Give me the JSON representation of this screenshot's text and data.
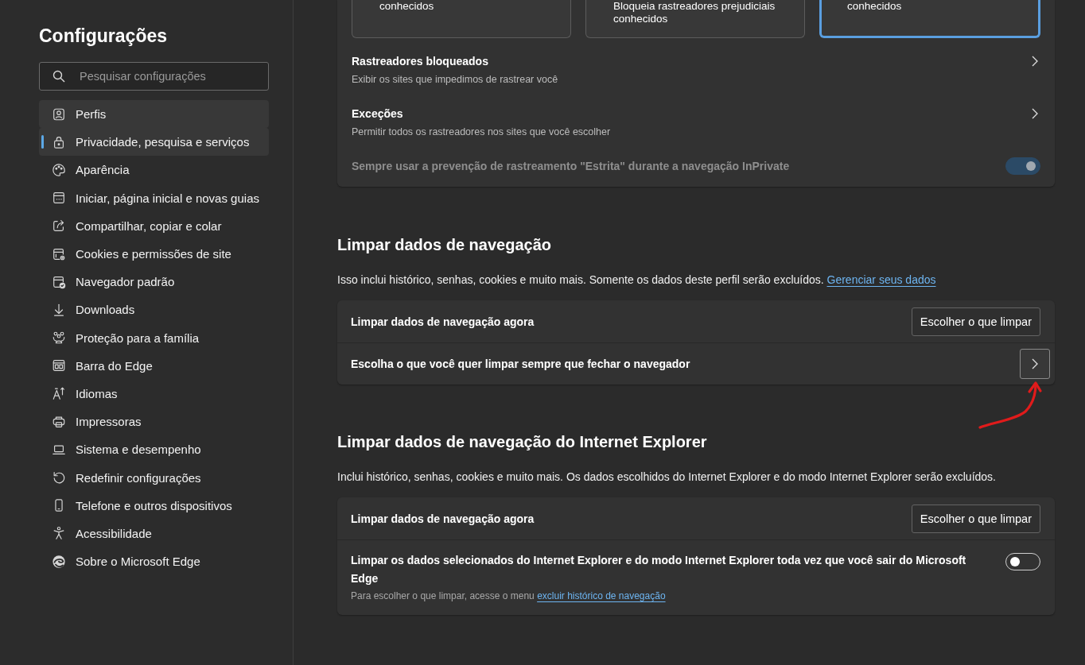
{
  "sidebar": {
    "title": "Configurações",
    "search": {
      "placeholder": "Pesquisar configurações"
    },
    "items": [
      {
        "label": "Perfis",
        "selected": false,
        "hovered": true
      },
      {
        "label": "Privacidade, pesquisa e serviços",
        "selected": true,
        "hovered": false
      },
      {
        "label": "Aparência",
        "selected": false,
        "hovered": false
      },
      {
        "label": "Iniciar, página inicial e novas guias",
        "selected": false,
        "hovered": false
      },
      {
        "label": "Compartilhar, copiar e colar",
        "selected": false,
        "hovered": false
      },
      {
        "label": "Cookies e permissões de site",
        "selected": false,
        "hovered": false
      },
      {
        "label": "Navegador padrão",
        "selected": false,
        "hovered": false
      },
      {
        "label": "Downloads",
        "selected": false,
        "hovered": false
      },
      {
        "label": "Proteção para a família",
        "selected": false,
        "hovered": false
      },
      {
        "label": "Barra do Edge",
        "selected": false,
        "hovered": false
      },
      {
        "label": "Idiomas",
        "selected": false,
        "hovered": false
      },
      {
        "label": "Impressoras",
        "selected": false,
        "hovered": false
      },
      {
        "label": "Sistema e desempenho",
        "selected": false,
        "hovered": false
      },
      {
        "label": "Redefinir configurações",
        "selected": false,
        "hovered": false
      },
      {
        "label": "Telefone e outros dispositivos",
        "selected": false,
        "hovered": false
      },
      {
        "label": "Acessibilidade",
        "selected": false,
        "hovered": false
      },
      {
        "label": "Sobre o Microsoft Edge",
        "selected": false,
        "hovered": false
      }
    ]
  },
  "tracking": {
    "levels": [
      {
        "lines": [
          "conhecidos"
        ],
        "selected": false
      },
      {
        "lines": [
          "Bloqueia rastreadores prejudiciais",
          "conhecidos"
        ],
        "selected": false
      },
      {
        "lines": [
          "conhecidos"
        ],
        "selected": true
      }
    ],
    "rows": [
      {
        "kind": "chevron",
        "label": "Rastreadores bloqueados",
        "description": "Exibir os sites que impedimos de rastrear você",
        "focused": false
      },
      {
        "kind": "chevron",
        "label": "Exceções",
        "description": "Permitir todos os rastreadores nos sites que você escolher",
        "focused": false
      },
      {
        "kind": "toggle",
        "label": "Sempre usar a prevenção de rastreamento \"Estrita\" durante a navegação InPrivate",
        "on": true,
        "disabled": true
      }
    ]
  },
  "sections": [
    {
      "title": "Limpar dados de navegação",
      "description": "Isso inclui histórico, senhas, cookies e muito mais. Somente os dados deste perfil serão excluídos.",
      "link": "Gerenciar seus dados",
      "rows": [
        {
          "kind": "button",
          "label": "Limpar dados de navegação agora",
          "button": "Escolher o que limpar"
        },
        {
          "kind": "chevron",
          "label": "Escolha o que você quer limpar sempre que fechar o navegador",
          "focused": true
        }
      ]
    },
    {
      "title": "Limpar dados de navegação do Internet Explorer",
      "description": "Inclui histórico, senhas, cookies e muito mais. Os dados escolhidos do Internet Explorer e do modo Internet Explorer serão excluídos.",
      "rows": [
        {
          "kind": "button",
          "label": "Limpar dados de navegação agora",
          "button": "Escolher o que limpar"
        },
        {
          "kind": "toggle",
          "label": "Limpar os dados selecionados do Internet Explorer e do modo Internet Explorer toda vez que você sair do Microsoft Edge",
          "description": "Para escolher o que limpar, acesse o menu",
          "link": "excluir histórico de navegação",
          "on": false,
          "disabled": false
        }
      ]
    }
  ]
}
